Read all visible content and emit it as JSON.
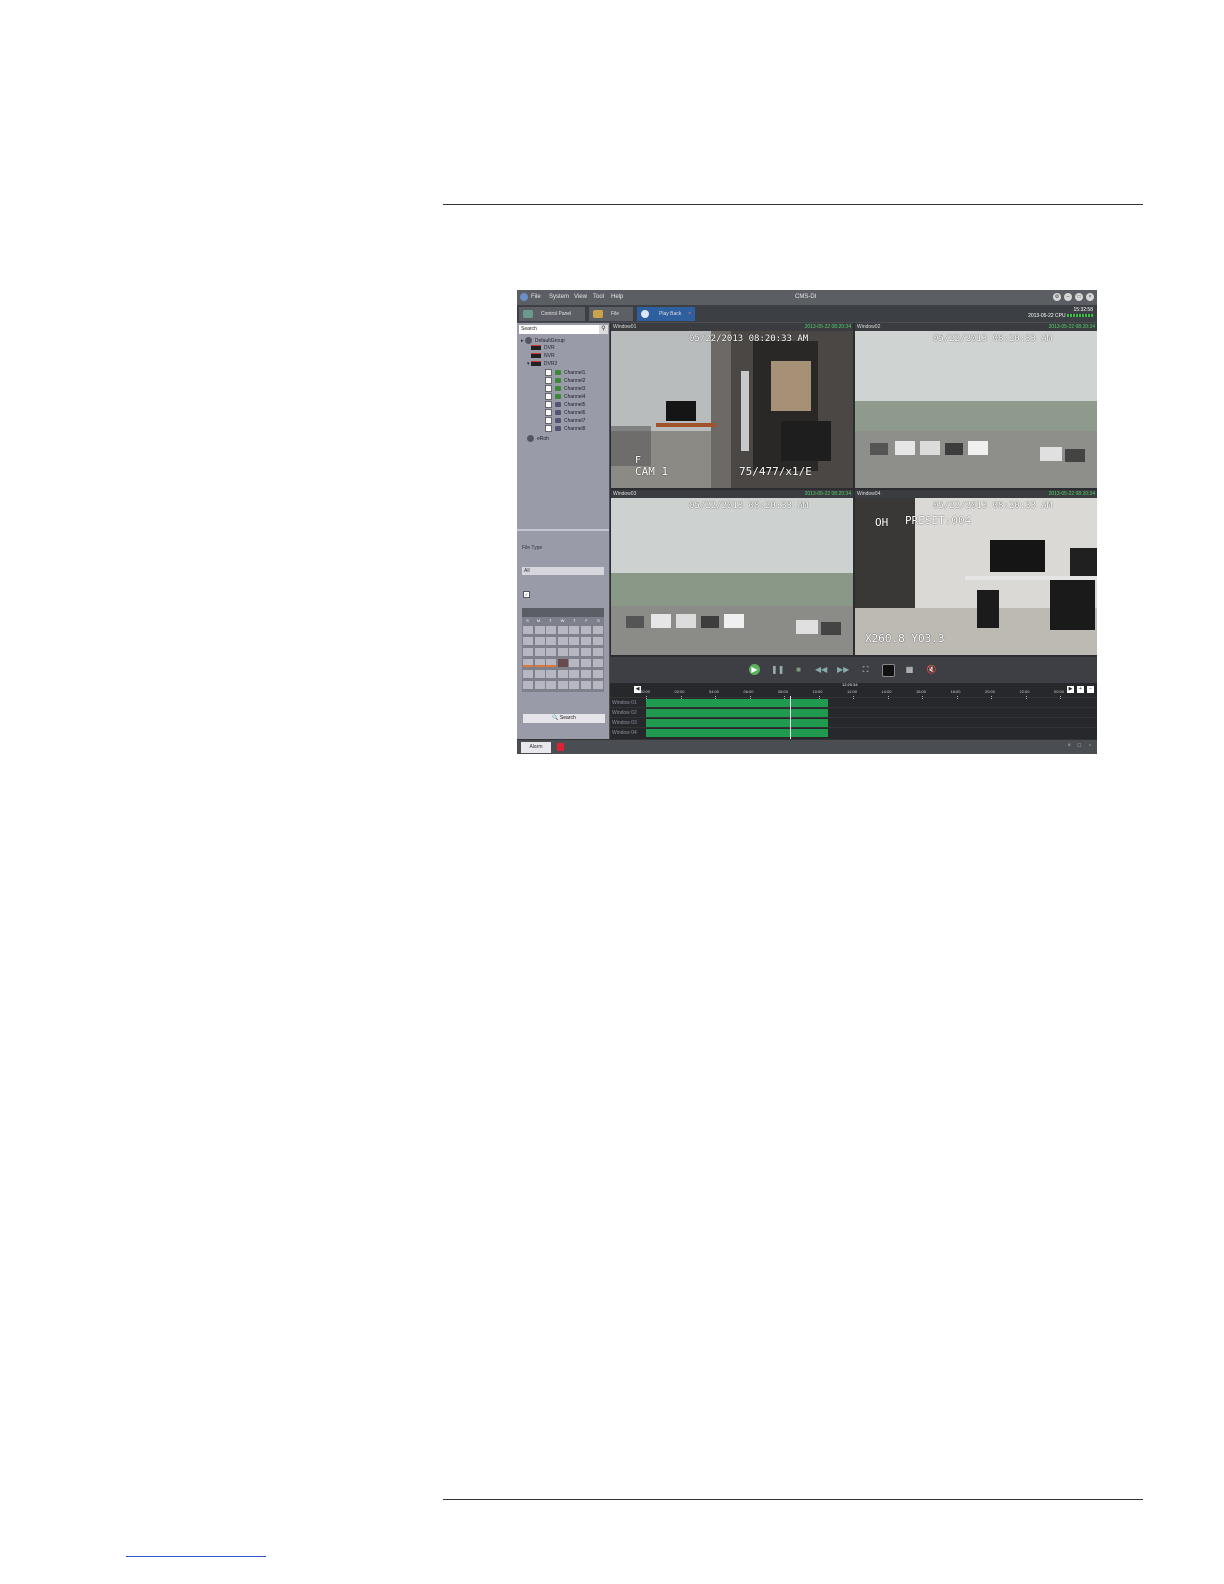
{
  "app": {
    "title": "CMS-DI",
    "menu": [
      "File",
      "System",
      "View",
      "Tool",
      "Help"
    ],
    "tabs": [
      {
        "label": "Control Panel"
      },
      {
        "label": "File"
      },
      {
        "label": "Play Back"
      }
    ],
    "clock": {
      "time": "15:32:58",
      "date": "2013-05-22",
      "cpu_label": "CPU"
    }
  },
  "left_panel": {
    "search_placeholder": "Search",
    "tree": {
      "group": "DefaultGroup",
      "devices": [
        "DVR",
        "NVR",
        "DVR2"
      ],
      "channels": [
        "Channel1",
        "Channel2",
        "Channel3",
        "Channel4",
        "Channel5",
        "Channel6",
        "Channel7",
        "Channel8"
      ],
      "other": "eRoh"
    },
    "file_type_label": "File Type",
    "file_type_value": "All",
    "calendar_dow": [
      "S",
      "M",
      "T",
      "W",
      "T",
      "F",
      "S"
    ],
    "search_button": "Search"
  },
  "windows": [
    {
      "name": "Window01",
      "timestamp": "2013-05-22 08:20:34",
      "osd_date": "05/22/2013 08:20:33 AM",
      "osd_cam": "CAM 1",
      "osd_extra": "75/477/x1/E",
      "osd_tag": "F"
    },
    {
      "name": "Window02",
      "timestamp": "2013-05-22 08:20:34",
      "osd_date": "05/22/2013 08:20:33 AM"
    },
    {
      "name": "Window03",
      "timestamp": "2013-05-22 08:20:34",
      "osd_date": "05/22/2013 08:20:33 AM"
    },
    {
      "name": "Window04",
      "timestamp": "2013-05-22 08:20:34",
      "osd_date": "05/22/2013 08:20:33 AM",
      "osd_preset": "PRESET:004",
      "osd_tag": "OH",
      "osd_xy": "X260.8  Y03.3"
    }
  ],
  "timeline": {
    "ticks": [
      "00:00",
      "02:00",
      "04:00",
      "06:00",
      "08:00",
      "10:00",
      "12:00",
      "14:00",
      "16:00",
      "18:00",
      "20:00",
      "22:00",
      "00:00"
    ],
    "cursor_time": "12:20:34",
    "rows": [
      "Window 01",
      "Window 02",
      "Window 03",
      "Window 04"
    ]
  },
  "statusbar": {
    "alarm_label": "Alarm"
  }
}
